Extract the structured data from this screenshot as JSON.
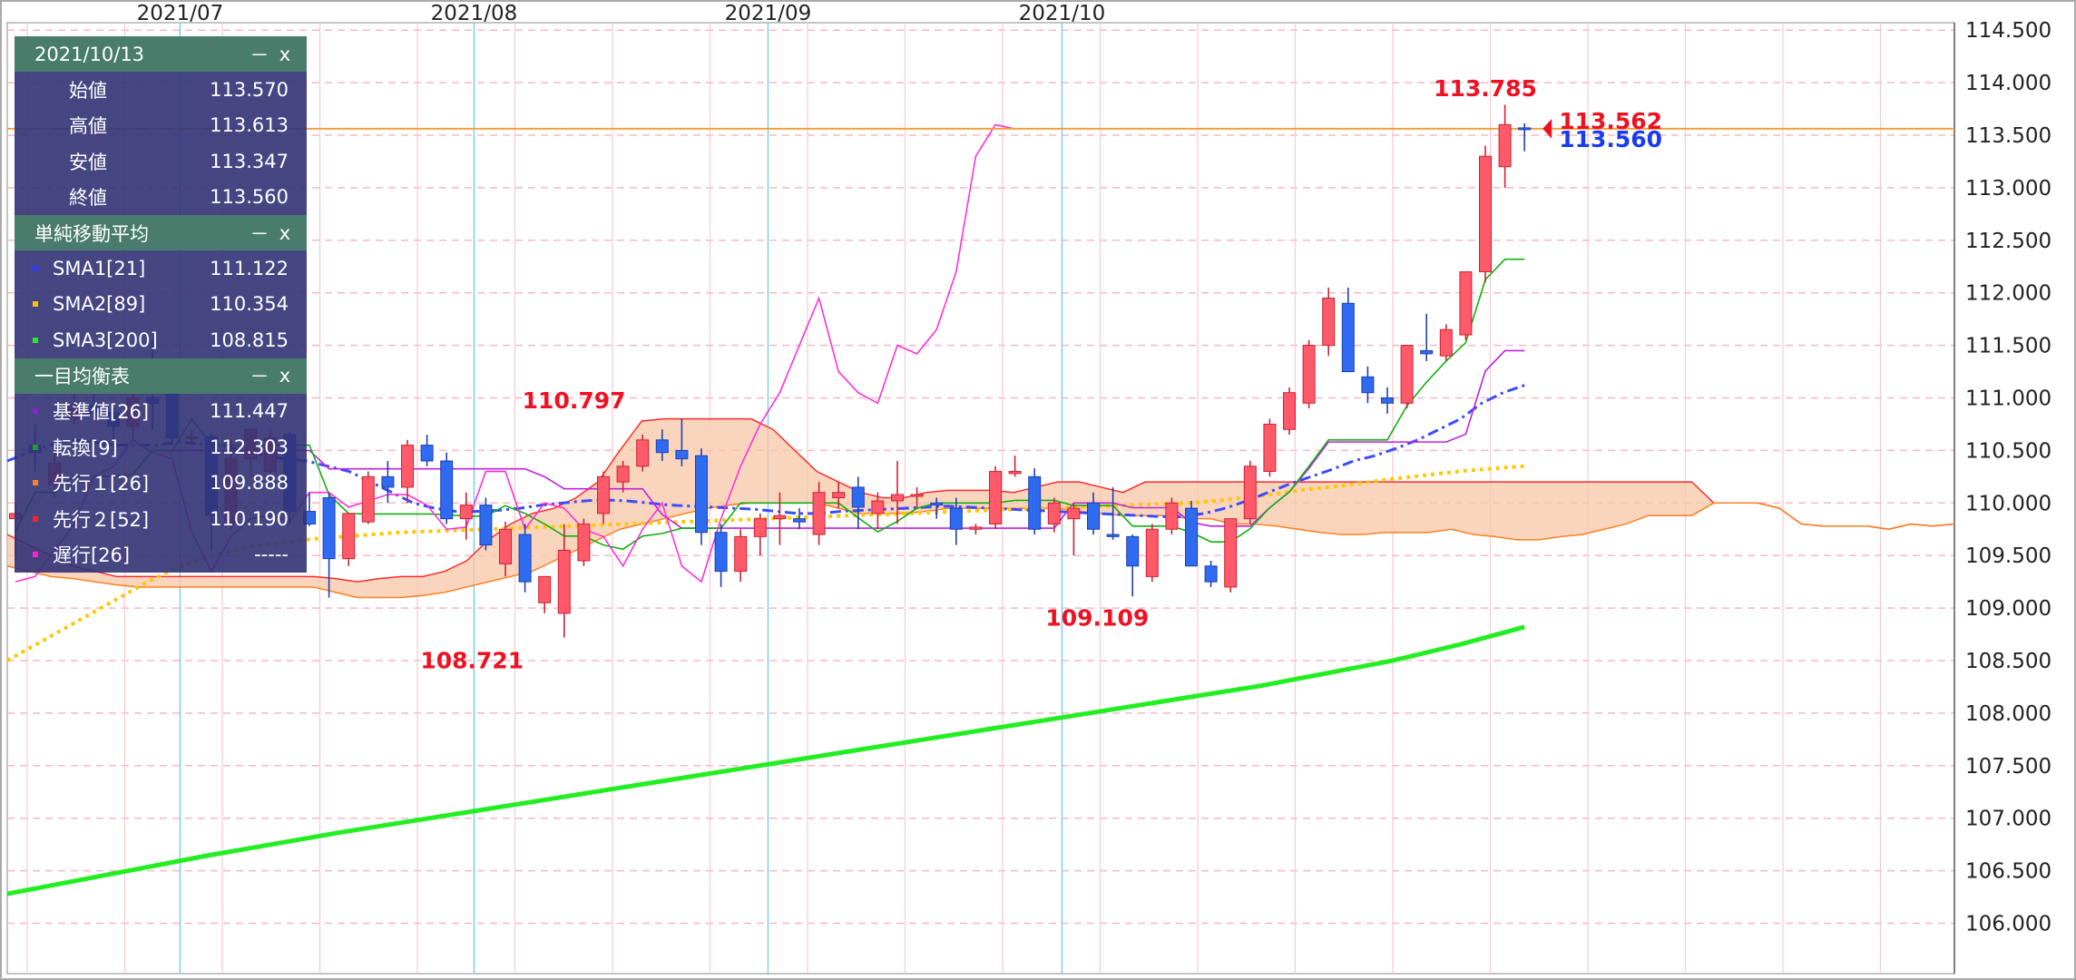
{
  "ohlc_panel": {
    "date": "2021/10/13",
    "minimize": "－",
    "close": "x",
    "rows": [
      {
        "label": "始値",
        "value": "113.570"
      },
      {
        "label": "高値",
        "value": "113.613"
      },
      {
        "label": "安値",
        "value": "113.347"
      },
      {
        "label": "終値",
        "value": "113.560"
      }
    ]
  },
  "sma_panel": {
    "title": "単純移動平均",
    "minimize": "－",
    "close": "x",
    "rows": [
      {
        "label": "SMA1[21]",
        "value": "111.122",
        "color": "#2a3cff"
      },
      {
        "label": "SMA2[89]",
        "value": "110.354",
        "color": "#ffc000"
      },
      {
        "label": "SMA3[200]",
        "value": "108.815",
        "color": "#22ee22"
      }
    ]
  },
  "ichimoku_panel": {
    "title": "一目均衡表",
    "minimize": "－",
    "close": "x",
    "rows": [
      {
        "label": "基準値[26]",
        "value": "111.447",
        "color": "#9020d0"
      },
      {
        "label": "転換[9]",
        "value": "112.303",
        "color": "#20a020"
      },
      {
        "label": "先行１[26]",
        "value": "109.888",
        "color": "#ff8020"
      },
      {
        "label": "先行２[52]",
        "value": "110.190",
        "color": "#ff2020"
      },
      {
        "label": "遅行[26]",
        "value": "-----",
        "color": "#ff20d0"
      }
    ]
  },
  "chart_data": {
    "type": "candlestick",
    "x_labels": [
      "2021/07",
      "2021/08",
      "2021/09",
      "2021/10"
    ],
    "y_ticks": [
      "114.500",
      "114.000",
      "113.500",
      "113.000",
      "112.500",
      "112.000",
      "111.500",
      "111.000",
      "110.500",
      "110.000",
      "109.500",
      "109.000",
      "108.500",
      "108.000",
      "107.500",
      "107.000",
      "106.500",
      "106.000"
    ],
    "ylim": [
      105.65,
      114.55
    ],
    "annotations": [
      {
        "text": "113.785",
        "value": 113.785
      },
      {
        "text": "110.797",
        "value": 110.797
      },
      {
        "text": "108.721",
        "value": 108.721
      },
      {
        "text": "109.109",
        "value": 109.109
      }
    ],
    "current_ask": "113.562",
    "current_bid": "113.560",
    "horizontal_line": 113.562,
    "candles": [
      {
        "o": 109.85,
        "h": 110.0,
        "l": 109.45,
        "c": 109.9
      },
      {
        "o": 110.55,
        "h": 110.75,
        "l": 110.3,
        "c": 110.48
      },
      {
        "o": 110.18,
        "h": 110.55,
        "l": 110.05,
        "c": 110.38
      },
      {
        "o": 110.8,
        "h": 111.06,
        "l": 110.75,
        "c": 110.93
      },
      {
        "o": 110.93,
        "h": 111.05,
        "l": 110.8,
        "c": 110.86
      },
      {
        "o": 110.86,
        "h": 110.9,
        "l": 110.6,
        "c": 110.73
      },
      {
        "o": 110.73,
        "h": 111.1,
        "l": 110.6,
        "c": 111.0
      },
      {
        "o": 111.0,
        "h": 111.55,
        "l": 110.7,
        "c": 110.95
      },
      {
        "o": 111.05,
        "h": 111.06,
        "l": 110.55,
        "c": 110.62
      },
      {
        "o": 110.62,
        "h": 110.7,
        "l": 110.55,
        "c": 110.63
      },
      {
        "o": 110.63,
        "h": 110.66,
        "l": 109.55,
        "c": 109.88
      },
      {
        "o": 109.8,
        "h": 110.6,
        "l": 109.75,
        "c": 110.42
      },
      {
        "o": 110.42,
        "h": 110.65,
        "l": 110.25,
        "c": 110.7
      },
      {
        "o": 110.3,
        "h": 110.69,
        "l": 110.2,
        "c": 110.62
      },
      {
        "o": 110.65,
        "h": 110.68,
        "l": 109.8,
        "c": 109.92
      },
      {
        "o": 109.92,
        "h": 110.1,
        "l": 109.78,
        "c": 109.8
      },
      {
        "o": 110.05,
        "h": 110.1,
        "l": 109.1,
        "c": 109.47
      },
      {
        "o": 109.47,
        "h": 109.9,
        "l": 109.4,
        "c": 109.9
      },
      {
        "o": 109.82,
        "h": 110.3,
        "l": 109.8,
        "c": 110.25
      },
      {
        "o": 110.25,
        "h": 110.4,
        "l": 110.0,
        "c": 110.15
      },
      {
        "o": 110.15,
        "h": 110.6,
        "l": 110.0,
        "c": 110.55
      },
      {
        "o": 110.55,
        "h": 110.65,
        "l": 110.35,
        "c": 110.4
      },
      {
        "o": 110.4,
        "h": 110.48,
        "l": 109.8,
        "c": 109.85
      },
      {
        "o": 109.85,
        "h": 110.1,
        "l": 109.65,
        "c": 109.98
      },
      {
        "o": 109.98,
        "h": 110.05,
        "l": 109.55,
        "c": 109.6
      },
      {
        "o": 109.42,
        "h": 109.82,
        "l": 109.3,
        "c": 109.75
      },
      {
        "o": 109.7,
        "h": 109.8,
        "l": 109.15,
        "c": 109.25
      },
      {
        "o": 109.05,
        "h": 109.3,
        "l": 108.95,
        "c": 109.3
      },
      {
        "o": 108.95,
        "h": 109.8,
        "l": 108.72,
        "c": 109.55
      },
      {
        "o": 109.45,
        "h": 109.85,
        "l": 109.4,
        "c": 109.8
      },
      {
        "o": 109.9,
        "h": 110.3,
        "l": 109.8,
        "c": 110.25
      },
      {
        "o": 110.2,
        "h": 110.4,
        "l": 110.1,
        "c": 110.35
      },
      {
        "o": 110.35,
        "h": 110.65,
        "l": 110.3,
        "c": 110.6
      },
      {
        "o": 110.6,
        "h": 110.7,
        "l": 110.4,
        "c": 110.48
      },
      {
        "o": 110.5,
        "h": 110.8,
        "l": 110.35,
        "c": 110.42
      },
      {
        "o": 110.45,
        "h": 110.52,
        "l": 109.6,
        "c": 109.72
      },
      {
        "o": 109.72,
        "h": 109.8,
        "l": 109.2,
        "c": 109.35
      },
      {
        "o": 109.35,
        "h": 109.75,
        "l": 109.25,
        "c": 109.68
      },
      {
        "o": 109.68,
        "h": 109.9,
        "l": 109.5,
        "c": 109.85
      },
      {
        "o": 109.85,
        "h": 110.1,
        "l": 109.6,
        "c": 109.88
      },
      {
        "o": 109.85,
        "h": 109.95,
        "l": 109.75,
        "c": 109.82
      },
      {
        "o": 109.7,
        "h": 110.2,
        "l": 109.6,
        "c": 110.1
      },
      {
        "o": 110.05,
        "h": 110.2,
        "l": 109.95,
        "c": 110.1
      },
      {
        "o": 110.15,
        "h": 110.25,
        "l": 109.75,
        "c": 109.96
      },
      {
        "o": 109.9,
        "h": 110.1,
        "l": 109.75,
        "c": 110.02
      },
      {
        "o": 110.02,
        "h": 110.4,
        "l": 109.8,
        "c": 110.08
      },
      {
        "o": 110.08,
        "h": 110.15,
        "l": 109.95,
        "c": 110.08
      },
      {
        "o": 110.0,
        "h": 110.05,
        "l": 109.85,
        "c": 109.98
      },
      {
        "o": 109.95,
        "h": 110.05,
        "l": 109.6,
        "c": 109.75
      },
      {
        "o": 109.75,
        "h": 109.8,
        "l": 109.7,
        "c": 109.77
      },
      {
        "o": 109.8,
        "h": 110.35,
        "l": 109.75,
        "c": 110.3
      },
      {
        "o": 110.28,
        "h": 110.45,
        "l": 110.25,
        "c": 110.3
      },
      {
        "o": 110.25,
        "h": 110.33,
        "l": 109.7,
        "c": 109.75
      },
      {
        "o": 109.8,
        "h": 110.05,
        "l": 109.72,
        "c": 110.0
      },
      {
        "o": 109.85,
        "h": 110.0,
        "l": 109.5,
        "c": 109.95
      },
      {
        "o": 110.0,
        "h": 110.1,
        "l": 109.7,
        "c": 109.75
      },
      {
        "o": 109.7,
        "h": 110.15,
        "l": 109.65,
        "c": 109.68
      },
      {
        "o": 109.68,
        "h": 109.7,
        "l": 109.11,
        "c": 109.4
      },
      {
        "o": 109.3,
        "h": 109.8,
        "l": 109.25,
        "c": 109.75
      },
      {
        "o": 109.75,
        "h": 110.05,
        "l": 109.7,
        "c": 110.0
      },
      {
        "o": 109.95,
        "h": 110.02,
        "l": 109.4,
        "c": 109.4
      },
      {
        "o": 109.4,
        "h": 109.45,
        "l": 109.2,
        "c": 109.25
      },
      {
        "o": 109.2,
        "h": 109.85,
        "l": 109.15,
        "c": 109.85
      },
      {
        "o": 109.85,
        "h": 110.4,
        "l": 109.8,
        "c": 110.35
      },
      {
        "o": 110.3,
        "h": 110.8,
        "l": 110.25,
        "c": 110.75
      },
      {
        "o": 110.7,
        "h": 111.1,
        "l": 110.65,
        "c": 111.05
      },
      {
        "o": 110.95,
        "h": 111.55,
        "l": 110.9,
        "c": 111.5
      },
      {
        "o": 111.5,
        "h": 112.05,
        "l": 111.4,
        "c": 111.95
      },
      {
        "o": 111.9,
        "h": 112.05,
        "l": 111.25,
        "c": 111.25
      },
      {
        "o": 111.2,
        "h": 111.3,
        "l": 110.95,
        "c": 111.05
      },
      {
        "o": 111.0,
        "h": 111.1,
        "l": 110.85,
        "c": 110.95
      },
      {
        "o": 110.95,
        "h": 111.5,
        "l": 110.9,
        "c": 111.5
      },
      {
        "o": 111.45,
        "h": 111.8,
        "l": 111.35,
        "c": 111.42
      },
      {
        "o": 111.4,
        "h": 111.7,
        "l": 111.35,
        "c": 111.65
      },
      {
        "o": 111.6,
        "h": 112.2,
        "l": 111.55,
        "c": 112.2
      },
      {
        "o": 112.2,
        "h": 113.4,
        "l": 112.1,
        "c": 113.3
      },
      {
        "o": 113.2,
        "h": 113.79,
        "l": 113.0,
        "c": 113.6
      },
      {
        "o": 113.57,
        "h": 113.613,
        "l": 113.347,
        "c": 113.56
      }
    ],
    "cloud": {
      "top": [
        109.7,
        109.6,
        109.5,
        109.4,
        109.35,
        109.3,
        109.3,
        109.3,
        109.3,
        109.3,
        109.3,
        109.3,
        109.3,
        109.3,
        109.3,
        109.28,
        109.25,
        109.28,
        109.3,
        109.3,
        109.35,
        109.45,
        109.65,
        109.8,
        109.9,
        109.95,
        110.05,
        110.2,
        110.5,
        110.78,
        110.8,
        110.8,
        110.8,
        110.8,
        110.8,
        110.7,
        110.5,
        110.3,
        110.2,
        110.1,
        110.05,
        110.05,
        110.1,
        110.12,
        110.12,
        110.12,
        110.1,
        110.15,
        110.2,
        110.2,
        110.15,
        110.1,
        110.2,
        110.2,
        110.2,
        110.2,
        110.2,
        110.2,
        110.2,
        110.2,
        110.2,
        110.2,
        110.2,
        110.2,
        110.2,
        110.2,
        110.2,
        110.2,
        110.2,
        110.2,
        110.2,
        110.2,
        110.2,
        110.2,
        110.2,
        110.2,
        110.2,
        110.2,
        110.0,
        110.0,
        110.0,
        109.95,
        109.8,
        109.78,
        109.78,
        109.78,
        109.75,
        109.8,
        109.78,
        109.8
      ],
      "bottom": [
        109.4,
        109.35,
        109.3,
        109.28,
        109.25,
        109.22,
        109.2,
        109.2,
        109.2,
        109.2,
        109.2,
        109.2,
        109.2,
        109.2,
        109.2,
        109.15,
        109.1,
        109.1,
        109.1,
        109.12,
        109.15,
        109.2,
        109.25,
        109.3,
        109.35,
        109.45,
        109.55,
        109.65,
        109.75,
        109.8,
        109.85,
        109.9,
        109.95,
        109.98,
        110.0,
        110.0,
        110.0,
        110.0,
        109.95,
        109.9,
        109.9,
        109.9,
        109.92,
        109.95,
        109.95,
        109.95,
        109.95,
        109.95,
        109.95,
        109.92,
        109.9,
        109.88,
        109.88,
        109.88,
        109.85,
        109.85,
        109.8,
        109.8,
        109.78,
        109.75,
        109.72,
        109.7,
        109.7,
        109.72,
        109.72,
        109.72,
        109.75,
        109.7,
        109.68,
        109.65,
        109.65,
        109.68,
        109.7,
        109.75,
        109.8,
        109.88,
        109.88,
        109.88,
        110.0,
        110.0,
        110.0,
        109.95,
        109.8,
        109.78,
        109.78,
        109.78,
        109.75,
        109.8,
        109.78,
        109.8
      ]
    },
    "sma21": [
      110.4,
      110.48,
      110.55,
      110.6,
      110.58,
      110.55,
      110.55,
      110.55,
      110.58,
      110.56,
      110.55,
      110.5,
      110.45,
      110.42,
      110.4,
      110.35,
      110.3,
      110.2,
      110.1,
      110.0,
      109.95,
      109.92,
      109.92,
      109.93,
      109.95,
      109.98,
      110.0,
      110.02,
      110.03,
      110.02,
      110.0,
      109.98,
      109.97,
      109.96,
      109.95,
      109.94,
      109.92,
      109.9,
      109.9,
      109.92,
      109.93,
      109.94,
      109.95,
      109.96,
      109.97,
      109.96,
      109.95,
      109.94,
      109.93,
      109.92,
      109.91,
      109.9,
      109.89,
      109.88,
      109.87,
      109.87,
      109.9,
      109.95,
      110.02,
      110.1,
      110.18,
      110.25,
      110.32,
      110.4,
      110.45,
      110.52,
      110.6,
      110.7,
      110.8,
      110.95,
      111.05,
      111.12
    ],
    "sma89": [
      108.5,
      108.65,
      108.8,
      108.95,
      109.1,
      109.25,
      109.38,
      109.48,
      109.55,
      109.6,
      109.63,
      109.66,
      109.68,
      109.7,
      109.72,
      109.73,
      109.74,
      109.75,
      109.76,
      109.77,
      109.78,
      109.79,
      109.8,
      109.81,
      109.82,
      109.83,
      109.84,
      109.85,
      109.86,
      109.87,
      109.88,
      109.89,
      109.9,
      109.91,
      109.92,
      109.93,
      109.94,
      109.95,
      109.96,
      109.97,
      109.98,
      109.99,
      110.0,
      110.02,
      110.05,
      110.08,
      110.12,
      110.15,
      110.18,
      110.22,
      110.25,
      110.28,
      110.31,
      110.33,
      110.35
    ],
    "sma200": [
      106.28,
      106.4,
      106.52,
      106.64,
      106.75,
      106.86,
      106.96,
      107.06,
      107.16,
      107.26,
      107.36,
      107.46,
      107.56,
      107.66,
      107.76,
      107.86,
      107.96,
      108.06,
      108.16,
      108.26,
      108.38,
      108.5,
      108.65,
      108.82
    ]
  }
}
